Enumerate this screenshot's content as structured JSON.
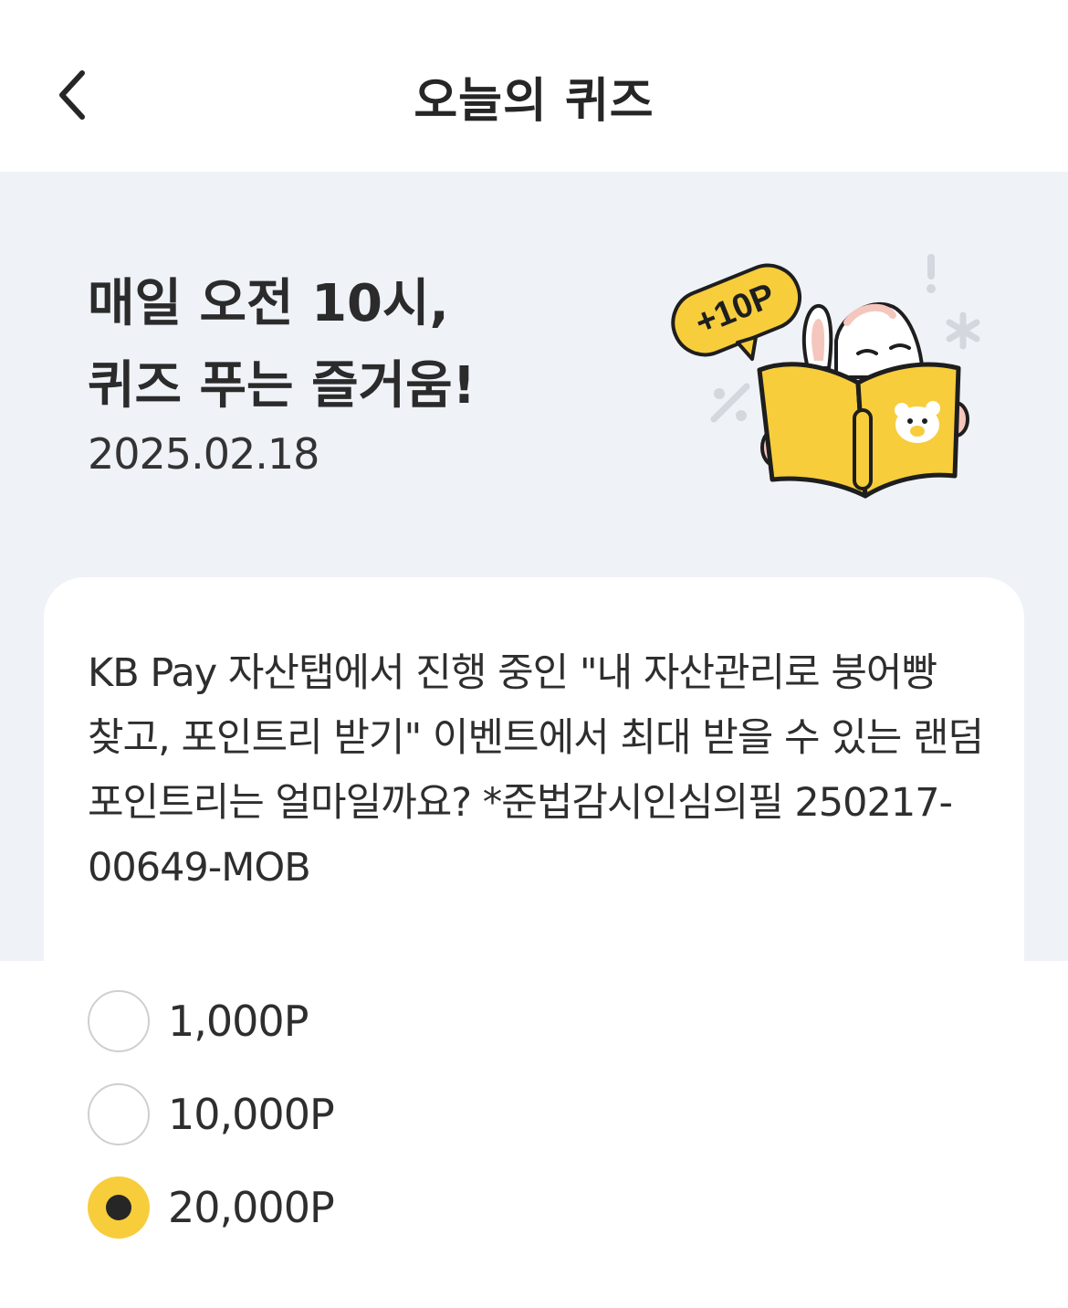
{
  "header": {
    "title": "오늘의 퀴즈",
    "back_icon": "chevron-left-icon"
  },
  "hero": {
    "title": "매일 오전 10시,\n퀴즈 푸는 즐거움!",
    "date": "2025.02.18",
    "badge_text": "+10P",
    "illustration": "rabbit-reading-book-illustration"
  },
  "quiz": {
    "question": "KB Pay 자산탭에서 진행 중인 \"내 자산관리로 붕어빵 찾고, 포인트리 받기\" 이벤트에서 최대 받을 수 있는 랜덤 포인트리는 얼마일까요? *준법감시인심의필 250217-00649-MOB",
    "options": [
      {
        "label": "1,000P",
        "selected": false
      },
      {
        "label": "10,000P",
        "selected": false
      },
      {
        "label": "20,000P",
        "selected": true
      }
    ]
  },
  "colors": {
    "accent": "#f7cd3c",
    "hero_bg": "#eff2f7",
    "text": "#262626"
  }
}
